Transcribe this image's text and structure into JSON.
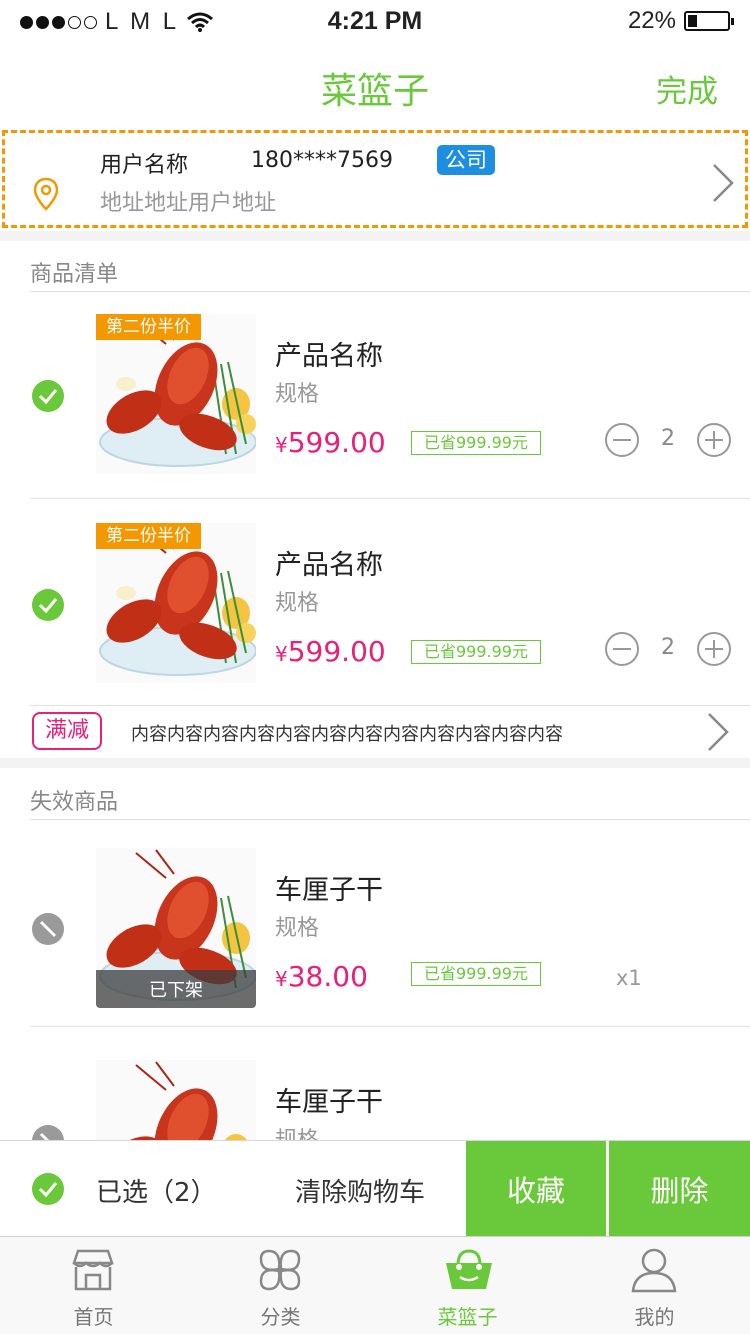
{
  "status_bar": {
    "carrier": "L M L",
    "time": "4:21 PM",
    "battery": "22%"
  },
  "nav": {
    "title": "菜篮子",
    "done": "完成"
  },
  "address": {
    "name": "用户名称",
    "phone": "180****7569",
    "tag": "公司",
    "line": "地址地址用户地址"
  },
  "cart": {
    "section_title": "商品清单",
    "items": [
      {
        "promo": "第二份半价",
        "name": "产品名称",
        "spec": "规格",
        "currency": "¥",
        "price": "599.00",
        "saved": "已省999.99元",
        "qty": "2"
      },
      {
        "promo": "第二份半价",
        "name": "产品名称",
        "spec": "规格",
        "currency": "¥",
        "price": "599.00",
        "saved": "已省999.99元",
        "qty": "2"
      }
    ],
    "promotion": {
      "badge": "满减",
      "text": "内容内容内容内容内容内容内容内容内容内容内容内容"
    }
  },
  "invalid": {
    "section_title": "失效商品",
    "items": [
      {
        "name": "车厘子干",
        "spec": "规格",
        "status": "已下架",
        "currency": "¥",
        "price": "38.00",
        "saved": "已省999.99元",
        "qty": "x1"
      },
      {
        "name": "车厘子干",
        "spec": "规格"
      }
    ]
  },
  "bottom": {
    "selected": "已选（2）",
    "clear": "清除购物车",
    "favorite": "收藏",
    "delete": "删除"
  },
  "tabs": [
    {
      "label": "首页",
      "icon": "store-icon"
    },
    {
      "label": "分类",
      "icon": "category-icon"
    },
    {
      "label": "菜篮子",
      "icon": "basket-icon"
    },
    {
      "label": "我的",
      "icon": "user-icon"
    }
  ],
  "colors": {
    "accent": "#6ac93a",
    "price": "#e8207a",
    "promo": "#f39800",
    "tag": "#1e8fe0"
  }
}
